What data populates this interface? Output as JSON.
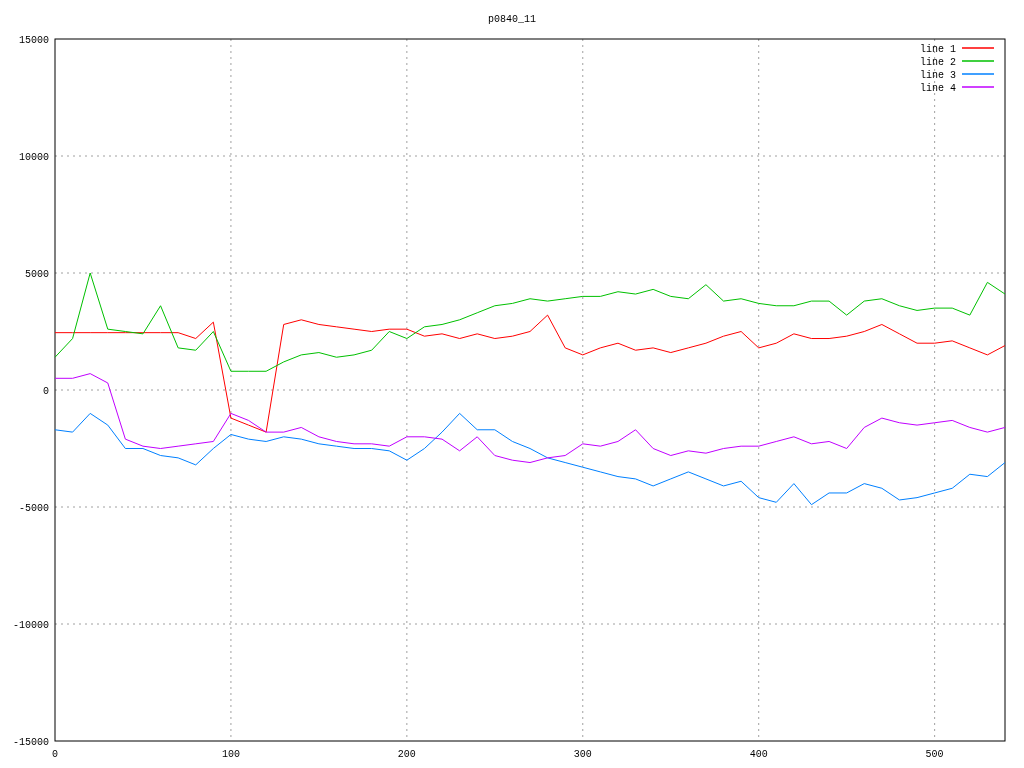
{
  "plot": {
    "chart_data": {
      "type": "line",
      "title": "p0840_11",
      "x": [
        0,
        10,
        20,
        30,
        40,
        50,
        60,
        70,
        80,
        90,
        100,
        110,
        120,
        130,
        140,
        150,
        160,
        170,
        180,
        190,
        200,
        210,
        220,
        230,
        240,
        250,
        260,
        270,
        280,
        290,
        300,
        310,
        320,
        330,
        340,
        350,
        360,
        370,
        380,
        390,
        400,
        410,
        420,
        430,
        440,
        450,
        460,
        470,
        480,
        490,
        500,
        510,
        520,
        530,
        540
      ],
      "series": [
        {
          "name": "line 1",
          "color": "#ff0000",
          "values": [
            2450,
            2450,
            2450,
            2450,
            2450,
            2450,
            2450,
            2450,
            2200,
            2900,
            -1200,
            -1500,
            -1800,
            2800,
            3000,
            2800,
            2700,
            2600,
            2500,
            2600,
            2600,
            2300,
            2400,
            2200,
            2400,
            2200,
            2300,
            2500,
            3200,
            1800,
            1500,
            1800,
            2000,
            1700,
            1800,
            1600,
            1800,
            2000,
            2300,
            2500,
            1800,
            2000,
            2400,
            2200,
            2200,
            2300,
            2500,
            2800,
            2400,
            2000,
            2000,
            2100,
            1800,
            1500,
            1900
          ]
        },
        {
          "name": "line 2",
          "color": "#00c000",
          "values": [
            1400,
            2200,
            5000,
            2600,
            2500,
            2400,
            3600,
            1800,
            1700,
            2500,
            800,
            800,
            800,
            1200,
            1500,
            1600,
            1400,
            1500,
            1700,
            2500,
            2200,
            2700,
            2800,
            3000,
            3300,
            3600,
            3700,
            3900,
            3800,
            3900,
            4000,
            4000,
            4200,
            4100,
            4300,
            4000,
            3900,
            4500,
            3800,
            3900,
            3700,
            3600,
            3600,
            3800,
            3800,
            3200,
            3800,
            3900,
            3600,
            3400,
            3500,
            3500,
            3200,
            4600,
            4100
          ]
        },
        {
          "name": "line 3",
          "color": "#0080ff",
          "values": [
            -1700,
            -1800,
            -1000,
            -1500,
            -2500,
            -2500,
            -2800,
            -2900,
            -3200,
            -2500,
            -1900,
            -2100,
            -2200,
            -2000,
            -2100,
            -2300,
            -2400,
            -2500,
            -2500,
            -2600,
            -3000,
            -2500,
            -1800,
            -1000,
            -1700,
            -1700,
            -2200,
            -2500,
            -2900,
            -3100,
            -3300,
            -3500,
            -3700,
            -3800,
            -4100,
            -3800,
            -3500,
            -3800,
            -4100,
            -3900,
            -4600,
            -4800,
            -4000,
            -4900,
            -4400,
            -4400,
            -4000,
            -4200,
            -4700,
            -4600,
            -4400,
            -4200,
            -3600,
            -3700,
            -3100
          ]
        },
        {
          "name": "line 4",
          "color": "#c000ff",
          "values": [
            500,
            500,
            700,
            300,
            -2100,
            -2400,
            -2500,
            -2400,
            -2300,
            -2200,
            -1000,
            -1300,
            -1800,
            -1800,
            -1600,
            -2000,
            -2200,
            -2300,
            -2300,
            -2400,
            -2000,
            -2000,
            -2100,
            -2600,
            -2000,
            -2800,
            -3000,
            -3100,
            -2900,
            -2800,
            -2300,
            -2400,
            -2200,
            -1700,
            -2500,
            -2800,
            -2600,
            -2700,
            -2500,
            -2400,
            -2400,
            -2200,
            -2000,
            -2300,
            -2200,
            -2500,
            -1600,
            -1200,
            -1400,
            -1500,
            -1400,
            -1300,
            -1600,
            -1800,
            -1600
          ]
        }
      ],
      "grid": true,
      "legend": true,
      "xlim": [
        0,
        540
      ],
      "ylim": [
        -15000,
        15000
      ],
      "xticks": [
        0,
        100,
        200,
        300,
        400,
        500
      ],
      "yticks": [
        -15000,
        -10000,
        -5000,
        0,
        5000,
        10000,
        15000
      ]
    }
  }
}
